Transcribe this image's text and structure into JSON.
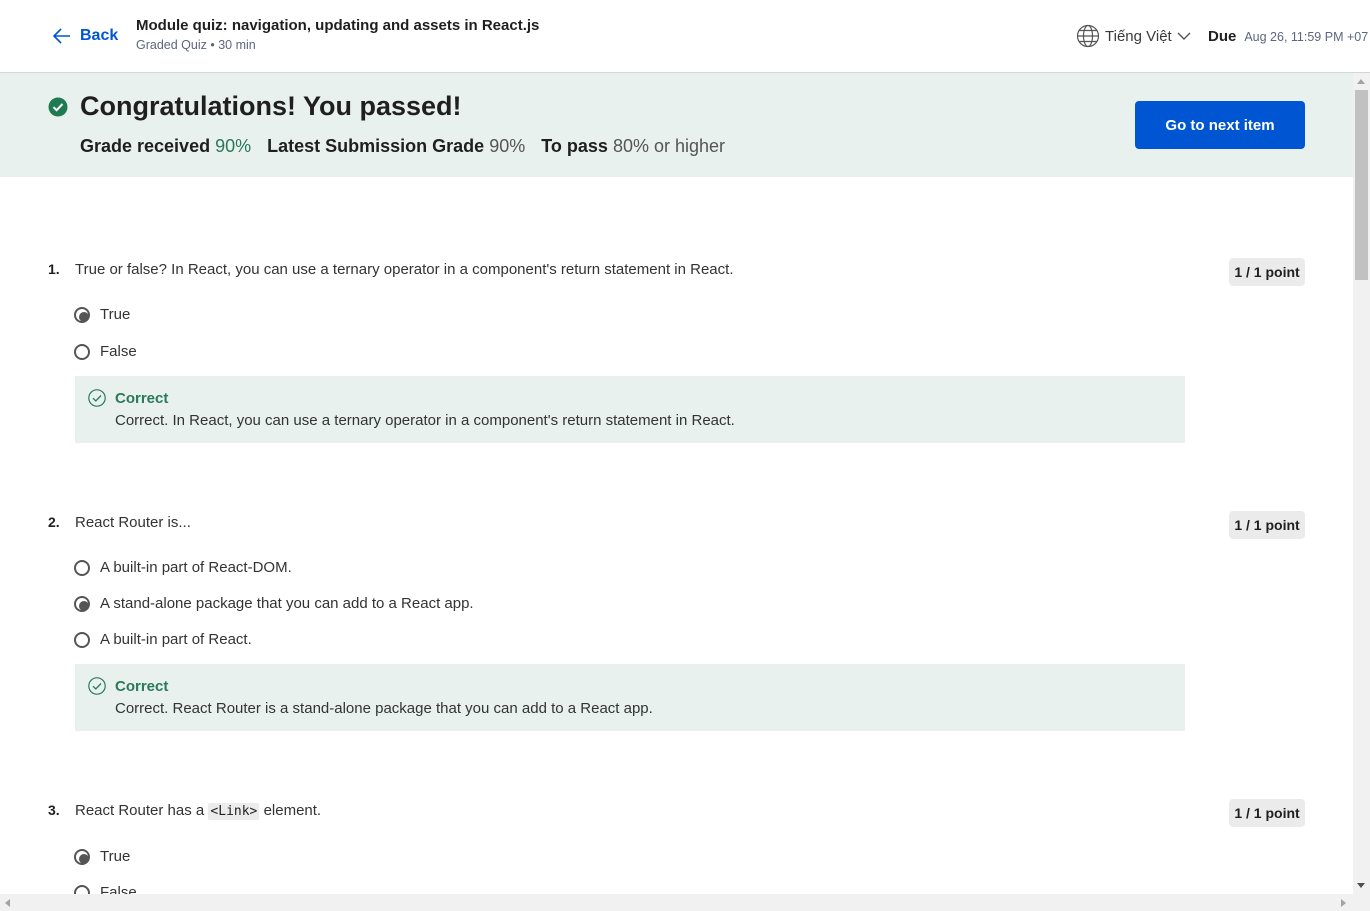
{
  "header": {
    "back_label": "Back",
    "title": "Module quiz: navigation, updating and assets in React.js",
    "subtitle": "Graded Quiz • 30 min",
    "language": "Tiếng Việt",
    "due_label": "Due",
    "due_date": "Aug 26, 11:59 PM +07"
  },
  "banner": {
    "title": "Congratulations! You passed!",
    "grade_received_label": "Grade received",
    "grade_received_value": "90%",
    "latest_label": "Latest Submission Grade",
    "latest_value": "90%",
    "to_pass_label": "To pass",
    "to_pass_value": "80% or higher",
    "next_button": "Go to next item"
  },
  "questions": [
    {
      "number": "1.",
      "text": "True or false? In React, you can use a ternary operator in a component's return statement in React.",
      "points": "1 / 1 point",
      "options": [
        {
          "label": "True",
          "selected": true
        },
        {
          "label": "False",
          "selected": false
        }
      ],
      "feedback_title": "Correct",
      "feedback_text": "Correct. In React, you can use a ternary operator in a component's return statement in React."
    },
    {
      "number": "2.",
      "text": "React Router is...",
      "points": "1 / 1 point",
      "options": [
        {
          "label": "A built-in part of React-DOM.",
          "selected": false
        },
        {
          "label": "A stand-alone package that you can add to a React app.",
          "selected": true
        },
        {
          "label": "A built-in part of React.",
          "selected": false
        }
      ],
      "feedback_title": "Correct",
      "feedback_text": "Correct. React Router is a stand-alone package that you can add to a React app."
    },
    {
      "number": "3.",
      "text_before": "React Router has a",
      "text_code": "<Link>",
      "text_after": "element.",
      "points": "1 / 1 point",
      "options": [
        {
          "label": "True",
          "selected": true
        },
        {
          "label": "False",
          "selected": false
        }
      ]
    }
  ],
  "colors": {
    "accent": "#0056d2",
    "success": "#2a7a5a",
    "banner_bg": "#e8f1ee"
  },
  "icons": {
    "back": "arrow-left-icon",
    "language": "globe-icon",
    "dropdown": "chevron-down-icon",
    "passed": "check-circle-filled-icon",
    "correct": "check-circle-outline-icon"
  }
}
